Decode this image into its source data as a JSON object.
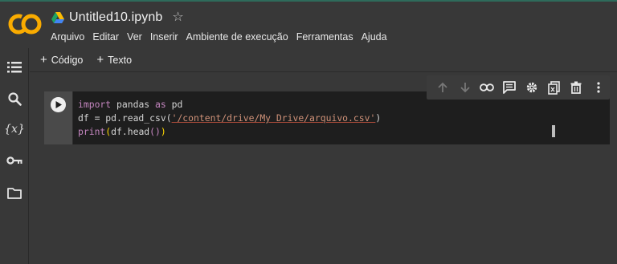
{
  "header": {
    "title": "Untitled10.ipynb",
    "logo_text": "CO",
    "logo_color": "#f9ab00",
    "icons": [
      "drive-icon",
      "star-icon"
    ]
  },
  "menu": {
    "items": [
      "Arquivo",
      "Editar",
      "Ver",
      "Inserir",
      "Ambiente de execução",
      "Ferramentas",
      "Ajuda"
    ]
  },
  "sidebar": {
    "icons": [
      "table-of-contents-icon",
      "search-icon",
      "variables-icon",
      "secrets-key-icon",
      "folder-icon"
    ],
    "variables_glyph": "{x}"
  },
  "toolbar": {
    "add_code_label": "Código",
    "add_text_label": "Texto"
  },
  "cell": {
    "lines": [
      {
        "kw1": "import",
        "mid1": " pandas ",
        "kw2": "as",
        "end": " pd"
      },
      {
        "pre": "df = pd.read_csv(",
        "str": "'/content/drive/My Drive/arquivo.csv'",
        "post": ")"
      },
      {
        "fn": "print",
        "open": "(",
        "mid": "df.head",
        "inner": "()",
        "close": ")"
      }
    ]
  },
  "cell_toolbar": {
    "icons": [
      "move-up-icon",
      "move-down-icon",
      "link-icon",
      "comment-icon",
      "settings-icon",
      "mirror-cell-icon",
      "delete-icon",
      "more-options-icon"
    ]
  },
  "colors": {
    "background": "#383838",
    "editor_background": "#1e1e1e",
    "keyword": "#c586c0",
    "string": "#ce9178",
    "bracket": "#ffd700",
    "accent_line": "#2e6b5b"
  }
}
